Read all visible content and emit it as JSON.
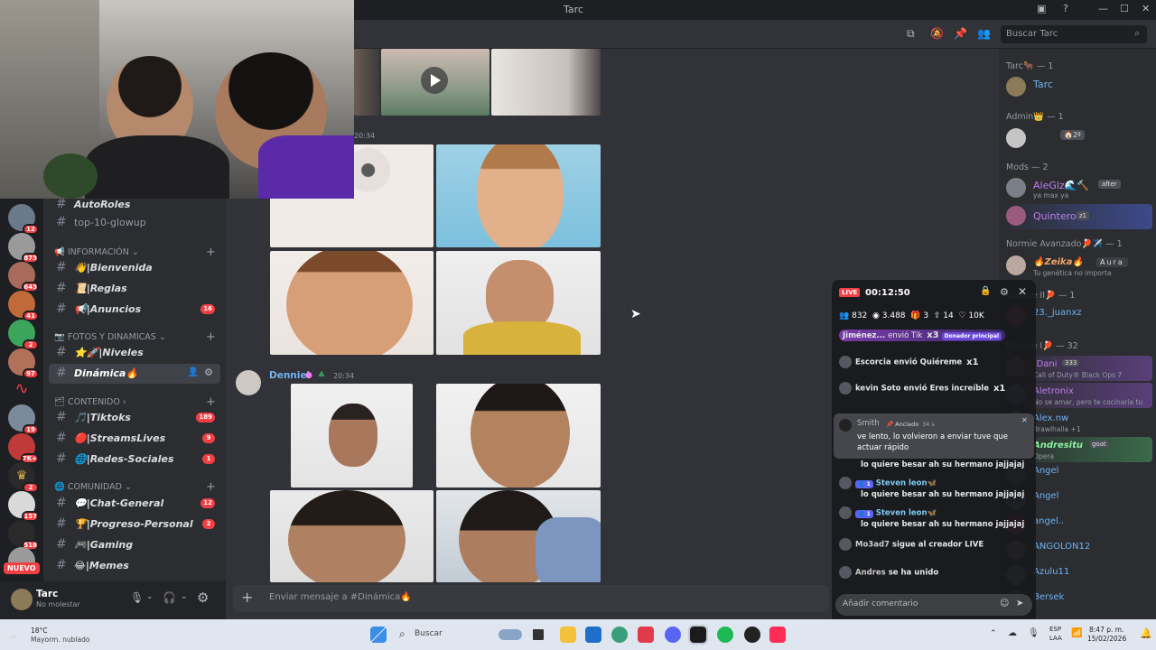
{
  "window": {
    "title": "Tarc",
    "controls": [
      "—",
      "☐",
      "✕"
    ]
  },
  "toolbar": {
    "search_placeholder": "Buscar Tarc"
  },
  "servers": [
    {
      "badge": "12"
    },
    {
      "badge": "873"
    },
    {
      "badge": "643"
    },
    {
      "badge": "41"
    },
    {
      "badge": "2"
    },
    {
      "badge": "97"
    },
    {
      "badge": ""
    },
    {
      "badge": "19"
    },
    {
      "badge": "7K+"
    },
    {
      "badge": "2"
    },
    {
      "badge": "157"
    },
    {
      "badge": "518"
    }
  ],
  "rail_new_label": "NUEVO",
  "channels": {
    "top_items": [
      {
        "name": "AutoRoles"
      },
      {
        "name": "top-10-glowup"
      }
    ],
    "categories": [
      {
        "label": "INFORMACIÓN",
        "items": [
          {
            "name": "👋|Bienvenida",
            "badge": ""
          },
          {
            "name": "📜|Reglas",
            "badge": ""
          },
          {
            "name": "📢|Anuncios",
            "badge": "16"
          }
        ]
      },
      {
        "label": "FOTOS Y DINAMICAS",
        "items": [
          {
            "name": "⭐🚀|Niveles",
            "badge": ""
          },
          {
            "name": "Dinámica🔥",
            "badge": "",
            "active": true
          }
        ]
      },
      {
        "label": "CONTENIDO",
        "items": [
          {
            "name": "🎵|Tiktoks",
            "badge": "189"
          },
          {
            "name": "🔴|StreamsLives",
            "badge": "9"
          },
          {
            "name": "🌐|Redes-Sociales",
            "badge": "1"
          }
        ]
      },
      {
        "label": "COMUNIDAD",
        "items": [
          {
            "name": "💬|Chat-General",
            "badge": "12"
          },
          {
            "name": "🏆|Progreso-Personal",
            "badge": "2"
          },
          {
            "name": "🎮|Gaming",
            "badge": ""
          },
          {
            "name": "😂|Memes",
            "badge": ""
          }
        ]
      }
    ]
  },
  "user_panel": {
    "name": "Tarc",
    "status": "No molestar"
  },
  "messages": [
    {
      "timestamp": "20:34"
    },
    {
      "author": "Denniel",
      "timestamp": "20:34"
    }
  ],
  "composer": {
    "placeholder": "Enviar mensaje a #Dinámica🔥"
  },
  "members": {
    "groups": [
      {
        "label": "Tarc🐂 — 1",
        "members": [
          {
            "name": "Tarc",
            "sub": ""
          }
        ]
      },
      {
        "label": "Admin👑 — 1",
        "members": [
          {
            "name": "",
            "sub": "",
            "tag": "🏠2ª"
          }
        ]
      },
      {
        "label": "Mods — 2",
        "members": [
          {
            "name": "AleGlz🌊🔨",
            "sub": "ya max ya",
            "tag": "after"
          },
          {
            "name": "Quintero",
            "sub": "",
            "tag": "z1"
          }
        ]
      },
      {
        "label": "Normie Avanzado🏓✈️ — 1",
        "members": [
          {
            "name": "🔥Zeika🔥",
            "sub": "Tu genética no importa",
            "tag": "Aura"
          }
        ]
      },
      {
        "label": "Normie II🏓 — 1",
        "members": [
          {
            "name": "23._juanxz",
            "sub": ""
          }
        ]
      },
      {
        "label": "Normie I🏓 — 32",
        "members": [
          {
            "name": "-Dani",
            "sub": "Call of Duty® Black Ops 7",
            "tag": "333"
          },
          {
            "name": "Aletronix",
            "sub": "No se amar, pero te cocinaria tu",
            "tag": ""
          },
          {
            "name": "Alex.nw",
            "sub": "Brawlhalla +1"
          },
          {
            "name": "Andresitu",
            "sub": "Opera",
            "tag": "goat"
          },
          {
            "name": "Angel",
            "sub": ""
          },
          {
            "name": "Angel",
            "sub": ""
          },
          {
            "name": "angel..",
            "sub": ""
          },
          {
            "name": "ANGOLON12",
            "sub": ""
          },
          {
            "name": "Azulu11",
            "sub": ""
          },
          {
            "name": "Bersek",
            "sub": ""
          }
        ]
      }
    ]
  },
  "live": {
    "badge": "LIVE",
    "time": "00:12:50",
    "stats": {
      "viewers": "832",
      "views": "3.488",
      "gifts": "3",
      "shares": "14",
      "likes": "10K"
    },
    "gifts": [
      {
        "user": "Jiménez...",
        "text": "envió Tik",
        "count": "x3",
        "pill": "Donador principal"
      },
      {
        "user": "Escorcia",
        "text": "envió Quiéreme",
        "count": "x1"
      },
      {
        "user": "kevin Soto",
        "text": "envió Eres increíble",
        "count": "x1"
      }
    ],
    "pinned": {
      "user": "Smith",
      "tag": "Anclado",
      "age": "34 s",
      "text": "ve lento, lo volvieron a enviar tuve que actuar rápido"
    },
    "comments": [
      {
        "user": "",
        "text": "lo quiere besar ah su hermano jajjajaj"
      },
      {
        "user": "Steven leon🦋",
        "level": "1",
        "text": "lo quiere besar ah su hermano jajjajaj"
      },
      {
        "user": "Steven leon🦋",
        "level": "1",
        "text": "lo quiere besar ah su hermano jajjajaj"
      },
      {
        "user": "Mo3ad7",
        "text": "sigue al creador LIVE"
      },
      {
        "user": "Andres",
        "text": "se ha unido"
      }
    ],
    "input_placeholder": "Añadir comentario"
  },
  "taskbar": {
    "weather_temp": "18°C",
    "weather_desc": "Mayorm. nublado",
    "search": "Buscar",
    "lang1": "ESP",
    "lang2": "LAA",
    "time": "8:47 p. m.",
    "date": "15/02/2026"
  }
}
